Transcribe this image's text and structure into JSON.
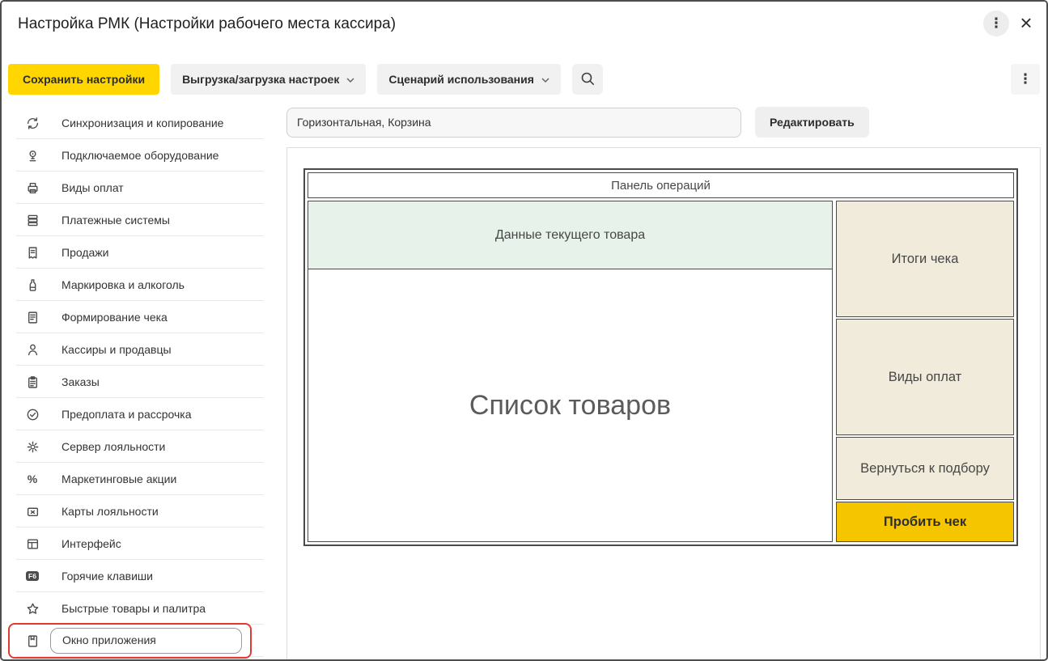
{
  "window": {
    "title": "Настройка РМК (Настройки рабочего места кассира)",
    "more_icon": "⋮",
    "close_icon": "×"
  },
  "toolbar": {
    "save_label": "Сохранить настройки",
    "export_dropdown_label": "Выгрузка/загрузка настроек",
    "scenario_dropdown_label": "Сценарий использования",
    "search_icon": "magnifier",
    "more_icon": "⋮"
  },
  "sidebar": {
    "items": [
      {
        "label": "Синхронизация и копирование",
        "icon": "sync-icon"
      },
      {
        "label": "Подключаемое оборудование",
        "icon": "connected-equipment-icon"
      },
      {
        "label": "Виды оплат",
        "icon": "payment-kinds-icon"
      },
      {
        "label": "Платежные системы",
        "icon": "payment-systems-icon"
      },
      {
        "label": "Продажи",
        "icon": "sales-icon"
      },
      {
        "label": "Маркировка и алкоголь",
        "icon": "marking-alcohol-icon"
      },
      {
        "label": "Формирование чека",
        "icon": "receipt-forming-icon"
      },
      {
        "label": "Кассиры и продавцы",
        "icon": "cashiers-icon"
      },
      {
        "label": "Заказы",
        "icon": "orders-icon"
      },
      {
        "label": "Предоплата и рассрочка",
        "icon": "prepayment-icon"
      },
      {
        "label": "Сервер лояльности",
        "icon": "loyalty-server-icon"
      },
      {
        "label": "Маркетинговые акции",
        "icon": "percent-icon",
        "badge": "%"
      },
      {
        "label": "Карты лояльности",
        "icon": "loyalty-cards-icon"
      },
      {
        "label": "Интерфейс",
        "icon": "interface-icon"
      },
      {
        "label": "Горячие клавиши",
        "icon": "hotkeys-icon",
        "badge": "F6"
      },
      {
        "label": "Быстрые товары и палитра",
        "icon": "quick-goods-icon"
      },
      {
        "label": "Окно приложения",
        "icon": "app-window-icon",
        "highlighted": true
      }
    ]
  },
  "main": {
    "layout_value": "Горизонтальная, Корзина",
    "edit_button_label": "Редактировать",
    "preview": {
      "operations_panel": "Панель операций",
      "current_item": "Данные текущего товара",
      "product_list": "Список товаров",
      "receipt_totals": "Итоги чека",
      "payment_types": "Виды оплат",
      "back_to_selection": "Вернуться к подбору",
      "ring_up_receipt": "Пробить чек"
    }
  },
  "colors": {
    "accent_yellow": "#FFD600",
    "gold": "#F5C500",
    "mint": "#E6F2EA",
    "cream": "#F0EBDB",
    "highlight_red": "#E23A2E"
  }
}
